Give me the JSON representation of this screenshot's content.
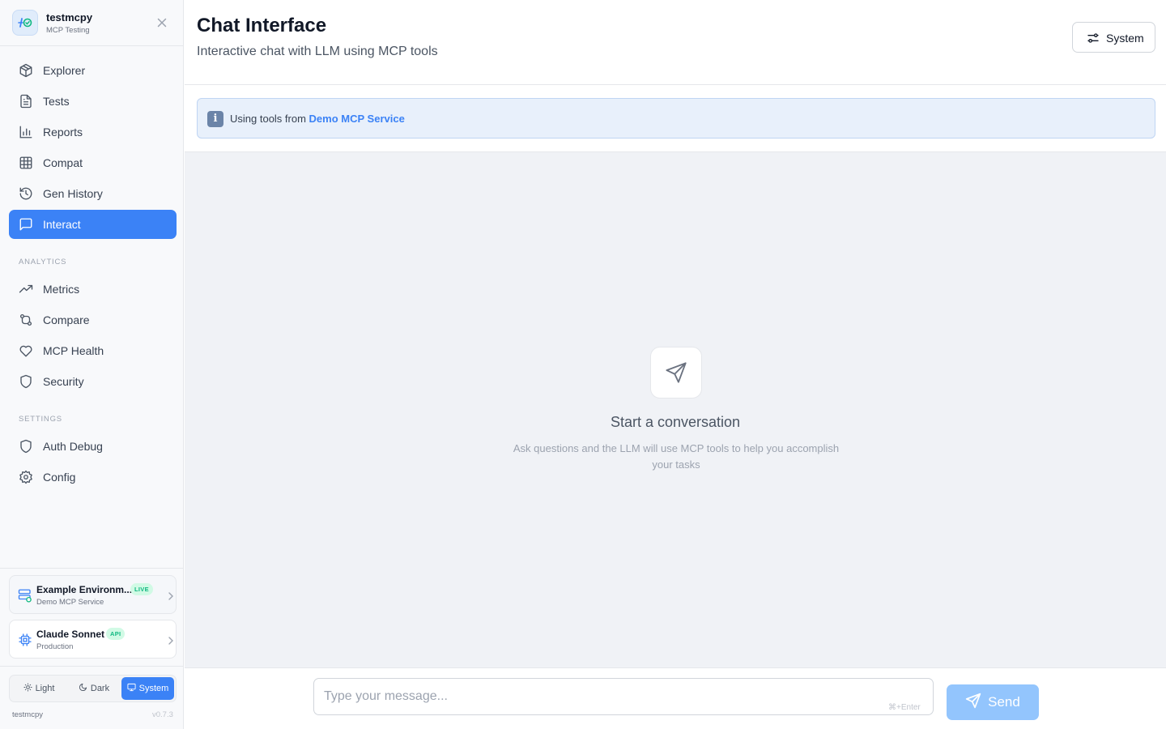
{
  "brand": {
    "name": "testmcpy",
    "subtitle": "MCP Testing"
  },
  "nav": {
    "main": [
      {
        "label": "Explorer",
        "icon": "box-icon"
      },
      {
        "label": "Tests",
        "icon": "file-text-icon"
      },
      {
        "label": "Reports",
        "icon": "bar-chart-icon"
      },
      {
        "label": "Compat",
        "icon": "grid-icon"
      },
      {
        "label": "Gen History",
        "icon": "history-icon"
      },
      {
        "label": "Interact",
        "icon": "message-square-icon",
        "active": true
      }
    ],
    "analytics_label": "ANALYTICS",
    "analytics": [
      {
        "label": "Metrics",
        "icon": "trending-up-icon"
      },
      {
        "label": "Compare",
        "icon": "git-compare-icon"
      },
      {
        "label": "MCP Health",
        "icon": "heart-icon"
      },
      {
        "label": "Security",
        "icon": "shield-icon"
      }
    ],
    "settings_label": "SETTINGS",
    "settings": [
      {
        "label": "Auth Debug",
        "icon": "shield-icon"
      },
      {
        "label": "Config",
        "icon": "gear-icon"
      }
    ]
  },
  "environment": {
    "title": "Example Environm...",
    "badge": "LIVE",
    "subtitle": "Demo MCP Service"
  },
  "model": {
    "title": "Claude Sonnet",
    "badge": "API",
    "subtitle": "Production"
  },
  "theme": {
    "options": [
      "Light",
      "Dark",
      "System"
    ],
    "selected": "System"
  },
  "footer": {
    "app": "testmcpy",
    "version": "v0.7.3"
  },
  "header": {
    "title": "Chat Interface",
    "subtitle": "Interactive chat with LLM using MCP tools",
    "theme_button": "System"
  },
  "banner": {
    "prefix": "Using tools from ",
    "service": "Demo MCP Service"
  },
  "empty_state": {
    "title": "Start a conversation",
    "description": "Ask questions and the LLM will use MCP tools to help you accomplish your tasks"
  },
  "composer": {
    "placeholder": "Type your message...",
    "shortcut": "⌘+Enter",
    "send_label": "Send"
  },
  "colors": {
    "accent": "#3b82f6",
    "send_disabled": "#93c5fd",
    "live": "#10b981"
  }
}
